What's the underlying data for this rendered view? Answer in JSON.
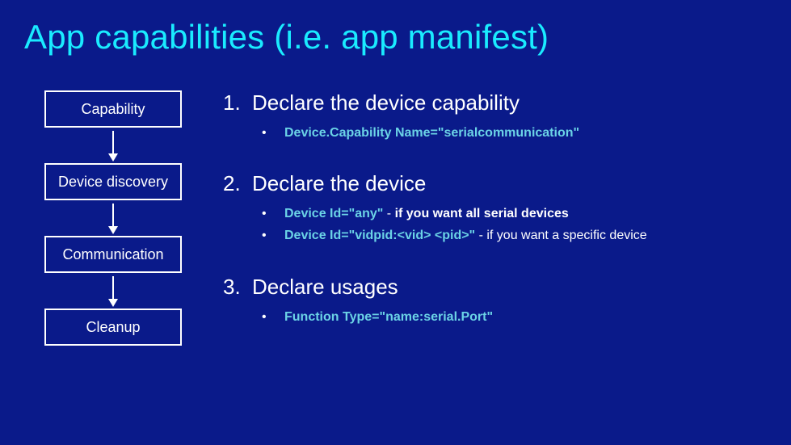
{
  "title": "App capabilities (i.e. app manifest)",
  "flow": {
    "box1": "Capability",
    "box2": "Device discovery",
    "box3": "Communication",
    "box4": "Cleanup"
  },
  "items": {
    "i1": {
      "num": "1.",
      "head": "Declare the device capability",
      "sub1": "Device.Capability Name=\"serialcommunication\""
    },
    "i2": {
      "num": "2.",
      "head": "Declare the device",
      "sub1_code": "Device Id=\"any\"",
      "sub1_sep": " - ",
      "sub1_rest": "if you want all serial devices",
      "sub2_code": "Device Id=\"vidpid:<vid> <pid>\"",
      "sub2_sep": " - ",
      "sub2_rest": "if you want a specific device"
    },
    "i3": {
      "num": "3.",
      "head": "Declare usages",
      "sub1": "Function Type=\"name:serial.Port\""
    }
  }
}
